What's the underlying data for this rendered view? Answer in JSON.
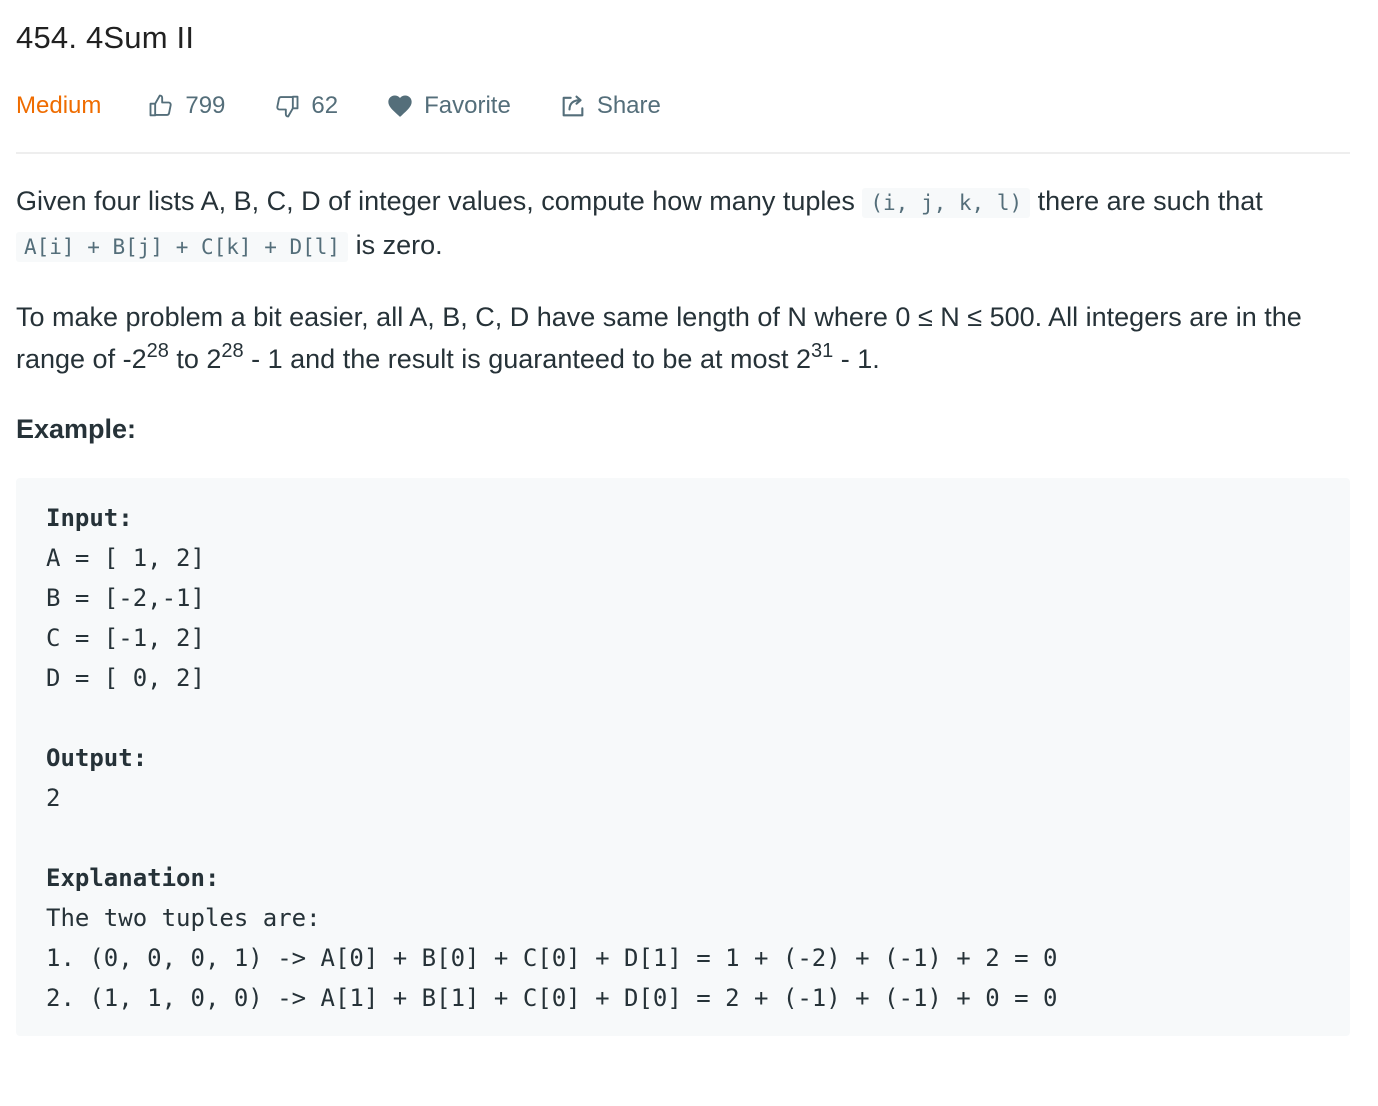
{
  "problem": {
    "title": "454. 4Sum II",
    "difficulty": "Medium",
    "difficulty_color": "#ef6c00",
    "likes": "799",
    "dislikes": "62",
    "favorite_label": "Favorite",
    "share_label": "Share"
  },
  "description": {
    "p1_text1": "Given four lists A, B, C, D of integer values, compute how many tuples ",
    "p1_code1": "(i, j, k, l)",
    "p1_text2": " there are such that ",
    "p1_code2": "A[i] + B[j] + C[k] + D[l]",
    "p1_text3": " is zero.",
    "p2_text1": "To make problem a bit easier, all A, B, C, D have same length of N where 0 ≤ N ≤ 500. All integers are in the range of -2",
    "p2_sup1": "28",
    "p2_text2": " to 2",
    "p2_sup2": "28",
    "p2_text3": " - 1 and the result is guaranteed to be at most 2",
    "p2_sup3": "31",
    "p2_text4": " - 1.",
    "example_label": "Example:"
  },
  "example": {
    "input_label": "Input:",
    "input_lines": [
      "A = [ 1, 2]",
      "B = [-2,-1]",
      "C = [-1, 2]",
      "D = [ 0, 2]"
    ],
    "output_label": "Output:",
    "output_value": "2",
    "explanation_label": "Explanation:",
    "explanation_lines": [
      "The two tuples are:",
      "1. (0, 0, 0, 1) -> A[0] + B[0] + C[0] + D[1] = 1 + (-2) + (-1) + 2 = 0",
      "2. (1, 1, 0, 0) -> A[1] + B[1] + C[0] + D[0] = 2 + (-1) + (-1) + 0 = 0"
    ]
  },
  "icons": {
    "like": "thumbs-up-icon",
    "dislike": "thumbs-down-icon",
    "favorite": "heart-icon",
    "share": "share-icon"
  }
}
